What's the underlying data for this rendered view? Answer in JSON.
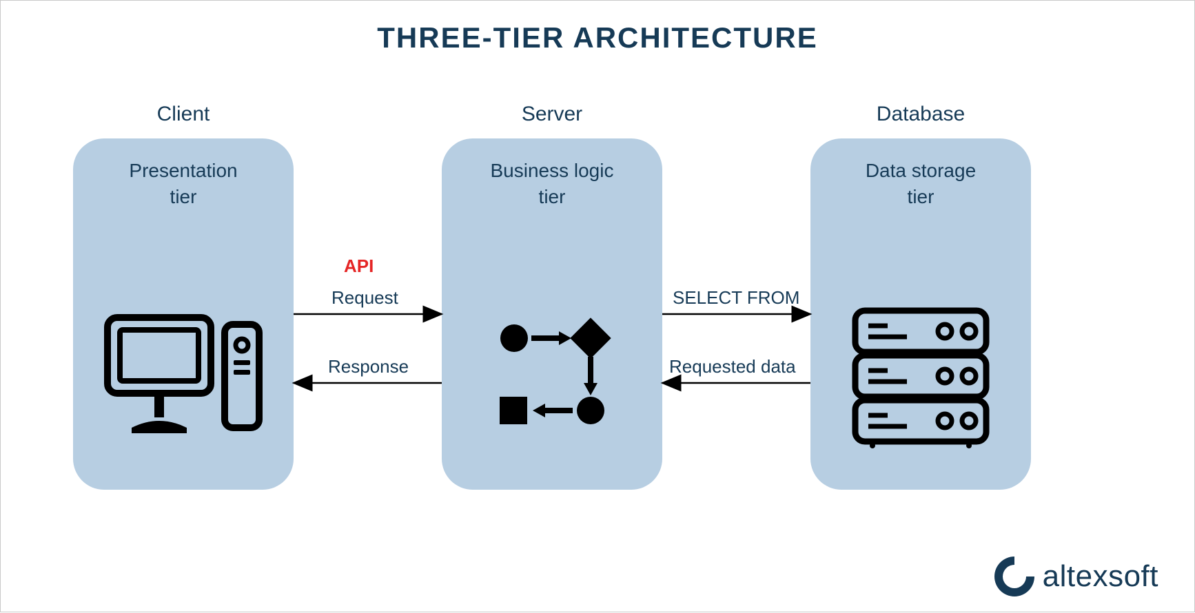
{
  "title": "THREE-TIER ARCHITECTURE",
  "tiers": [
    {
      "label": "Client",
      "name_line1": "Presentation",
      "name_line2": "tier"
    },
    {
      "label": "Server",
      "name_line1": "Business logic",
      "name_line2": "tier"
    },
    {
      "label": "Database",
      "name_line1": "Data storage",
      "name_line2": "tier"
    }
  ],
  "connections": {
    "api": "API",
    "request": "Request",
    "response": "Response",
    "select": "SELECT FROM",
    "requested": "Requested data"
  },
  "branding": {
    "name": "altexsoft"
  },
  "colors": {
    "primary": "#163a56",
    "tier_fill": "#b7cee2",
    "accent_red": "#e52525"
  }
}
